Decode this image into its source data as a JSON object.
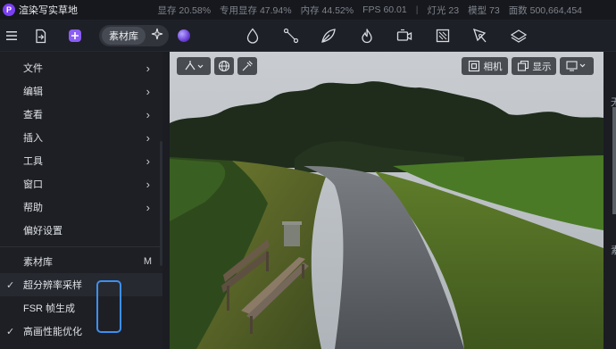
{
  "app": {
    "logo_letter": "P",
    "title": "渲染写实草地"
  },
  "stats": {
    "vram": "显存 20.58%",
    "dedicated_vram": "专用显存 47.94%",
    "memory": "内存 44.52%",
    "fps": "FPS 60.01",
    "separator": "|",
    "lights": "灯光 23",
    "models": "模型 73",
    "faces": "面数 500,664,454"
  },
  "toolbar": {
    "hamburger_icon": "menu-icon",
    "export_icon": "export-file-icon",
    "add_icon": "add-plugin-icon",
    "library_label": "素材库",
    "sparkle_icon": "sparkle-icon",
    "tools": [
      "drop-icon",
      "path-icon",
      "leaf-icon",
      "fire-icon",
      "camera-video-icon",
      "slash-square-icon",
      "pen-tool-icon",
      "layers-icon"
    ]
  },
  "menu": {
    "items": [
      {
        "label": "文件",
        "chevron": "›"
      },
      {
        "label": "编辑",
        "chevron": "›"
      },
      {
        "label": "查看",
        "chevron": "›"
      },
      {
        "label": "插入",
        "chevron": "›"
      },
      {
        "label": "工具",
        "chevron": "›"
      },
      {
        "label": "窗口",
        "chevron": "›"
      },
      {
        "label": "帮助",
        "chevron": "›"
      },
      {
        "label": "偏好设置",
        "chevron": ""
      }
    ],
    "library": {
      "label": "素材库",
      "shortcut": "M"
    },
    "toggles": [
      {
        "label": "超分辨率采样",
        "checked": true,
        "check": "✓"
      },
      {
        "label": "FSR 帧生成",
        "checked": false,
        "check": ""
      },
      {
        "label": "高画性能优化",
        "checked": true,
        "check": "✓"
      }
    ]
  },
  "viewport": {
    "camera_label": "相机",
    "display_label": "显示",
    "chevron_glyph": "⌄"
  },
  "right_panel": {
    "text1": "无",
    "text2": "素"
  },
  "colors": {
    "accent": "#3d8ff0",
    "brand": "#7b3ff2",
    "panel_bg": "#1d1f25"
  }
}
